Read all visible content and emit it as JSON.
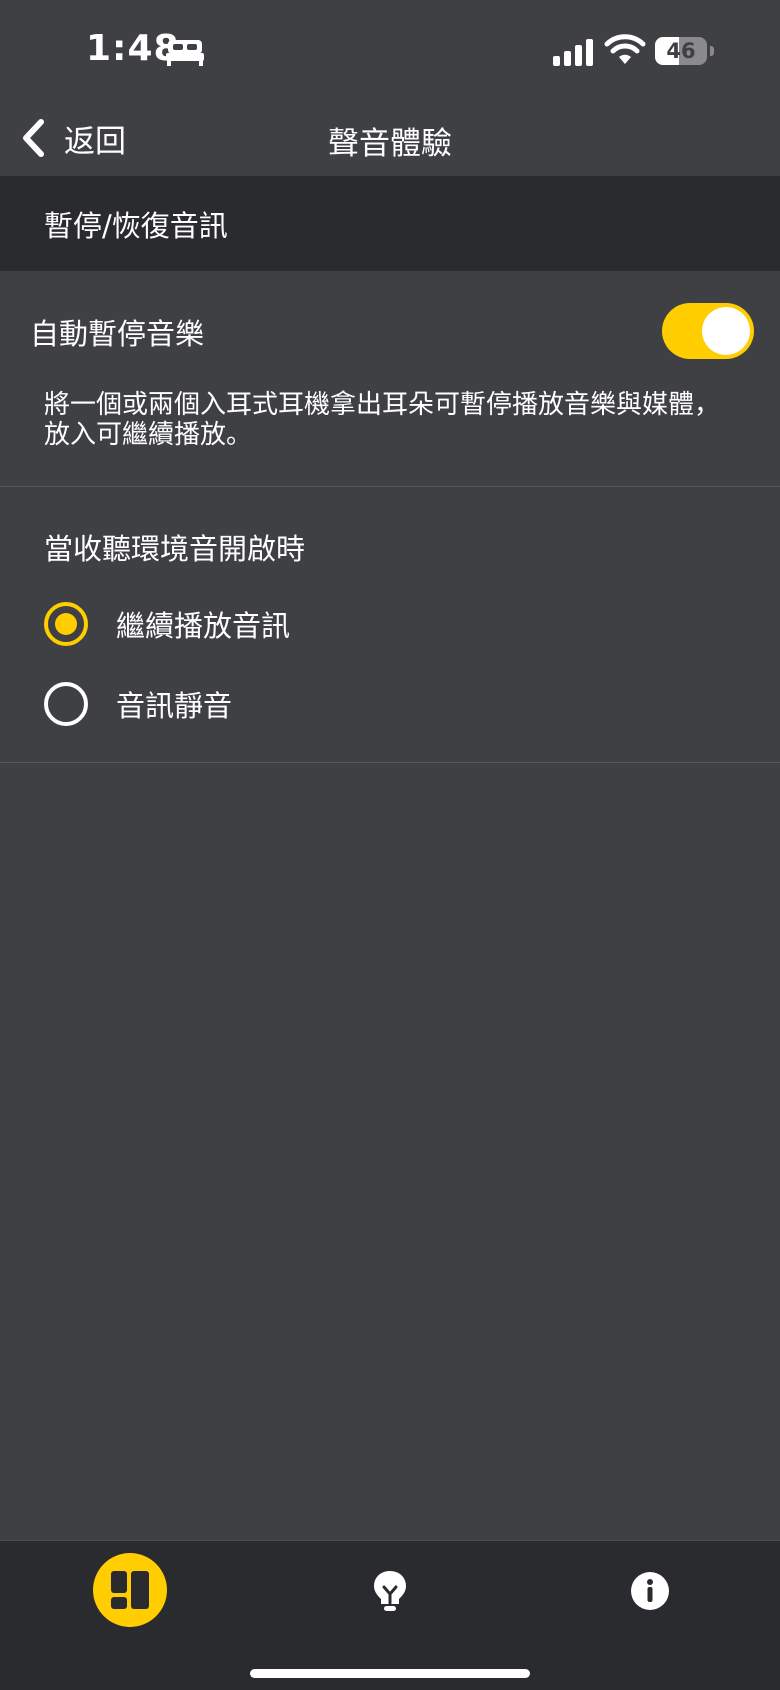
{
  "status_bar": {
    "time": "1:48",
    "battery_level": "46",
    "battery_fraction": 0.46
  },
  "nav": {
    "back_label": "返回",
    "title": "聲音體驗"
  },
  "section": {
    "title": "暫停/恢復音訊"
  },
  "auto_pause": {
    "label": "自動暫停音樂",
    "enabled": true,
    "description": "將一個或兩個入耳式耳機拿出耳朵可暫停播放音樂與媒體，放入可繼續播放。"
  },
  "ambient": {
    "title": "當收聽環境音開啟時",
    "options": [
      {
        "label": "繼續播放音訊",
        "selected": true
      },
      {
        "label": "音訊靜音",
        "selected": false
      }
    ]
  },
  "tab_bar": {
    "items": [
      {
        "icon": "dashboard-icon",
        "active": true
      },
      {
        "icon": "lightbulb-icon",
        "active": false
      },
      {
        "icon": "info-icon",
        "active": false
      }
    ]
  },
  "colors": {
    "accent": "#ffcd00",
    "background": "#3f4044",
    "header_background": "#2a2b2e"
  }
}
